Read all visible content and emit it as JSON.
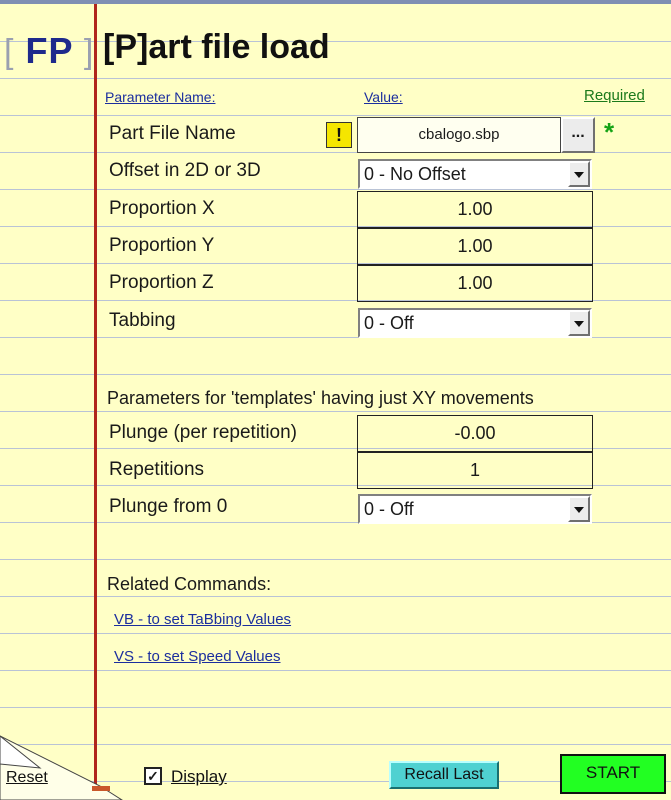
{
  "header": {
    "logo_open": "[",
    "logo_text": "FP",
    "logo_close": "]",
    "title": "[P]art file load"
  },
  "columns": {
    "name": "Parameter Name:",
    "value": "Value:",
    "required": "Required"
  },
  "params": {
    "part_file": {
      "label": "Part File Name",
      "value": "cbalogo.sbp",
      "warn_icon": "!",
      "browse": "...",
      "required_mark": "*"
    },
    "offset": {
      "label": "Offset in 2D or 3D",
      "value": "0 - No Offset"
    },
    "prop_x": {
      "label": "Proportion X",
      "value": "1.00"
    },
    "prop_y": {
      "label": "Proportion Y",
      "value": "1.00"
    },
    "prop_z": {
      "label": "Proportion Z",
      "value": "1.00"
    },
    "tabbing": {
      "label": "Tabbing",
      "value": "0 - Off"
    }
  },
  "templates": {
    "heading": "Parameters for 'templates' having just XY movements",
    "plunge": {
      "label": "Plunge (per repetition)",
      "value": "-0.00"
    },
    "repetitions": {
      "label": "Repetitions",
      "value": "1"
    },
    "plunge_from_0": {
      "label": "Plunge from 0",
      "value": "0 - Off"
    }
  },
  "related": {
    "heading": "Related Commands:",
    "links": [
      "VB - to set TaBbing Values",
      "VS - to set Speed Values"
    ]
  },
  "footer": {
    "reset": "Reset",
    "display_label": "Display",
    "display_checked": true,
    "check_mark": "✓",
    "recall": "Recall Last",
    "start": "START"
  },
  "colors": {
    "paper": "#ffffc6",
    "margin_line": "#b0261c",
    "link": "#1b2e9e",
    "start": "#22ff22",
    "recall": "#4fd1d1",
    "warn": "#f5e600"
  }
}
